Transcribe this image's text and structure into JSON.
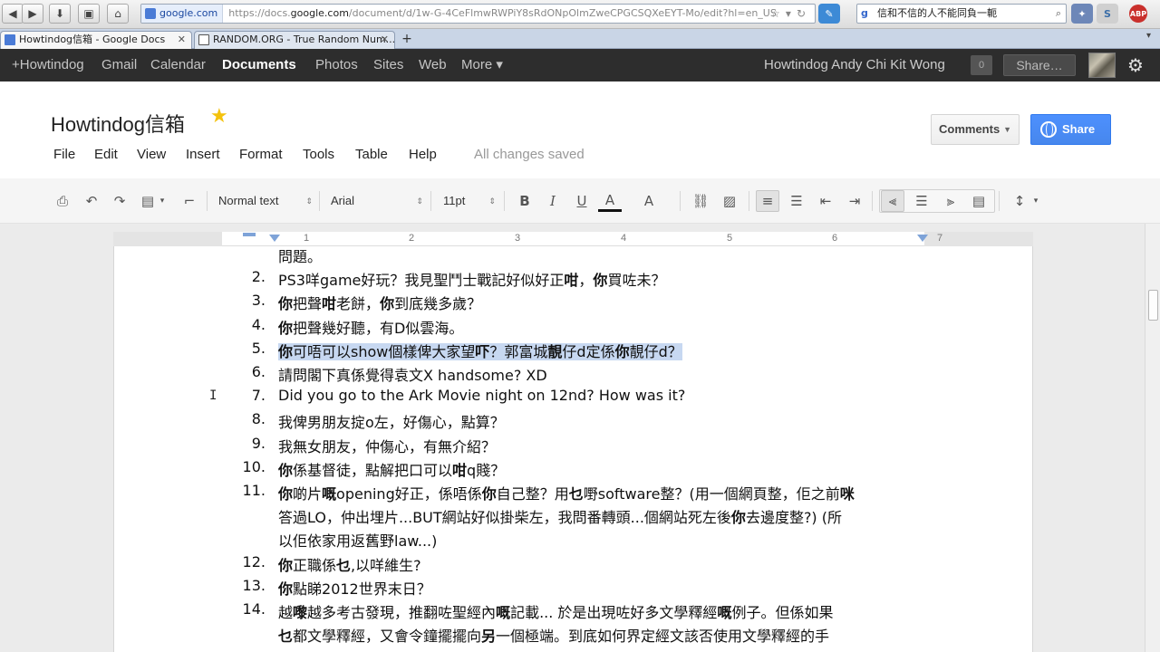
{
  "browser": {
    "url_domain": "google.com",
    "url_prefix": "https://docs.",
    "url_host": "google.com",
    "url_path": "/document/d/1w-G-4CeFlmwRWPiY8sRdONpOlmZweCPGCSQXeEYT-Mo/edit?hl=en_US",
    "search_text": "信和不信的人不能同負一軛",
    "tabs": [
      {
        "label": "Howtindog信箱 - Google Docs",
        "active": true,
        "color": "#4a7bd6"
      },
      {
        "label": "RANDOM.ORG - True Random Num...",
        "active": false,
        "color": "#555555"
      }
    ]
  },
  "gbar": {
    "links": [
      "+Howtindog",
      "Gmail",
      "Calendar",
      "Documents",
      "Photos",
      "Sites",
      "Web",
      "More ▾"
    ],
    "active": "Documents",
    "user": "Howtindog Andy Chi Kit Wong",
    "notification_count": "0",
    "share_label": "Share…"
  },
  "doc": {
    "title": "Howtindog信箱",
    "menu": [
      "File",
      "Edit",
      "View",
      "Insert",
      "Format",
      "Tools",
      "Table",
      "Help"
    ],
    "save_status": "All changes saved",
    "comments_label": "Comments",
    "share_label": "Share"
  },
  "toolbar": {
    "style": "Normal text",
    "font": "Arial",
    "size": "11pt"
  },
  "ruler": {
    "numbers": [
      "1",
      "2",
      "3",
      "4",
      "5",
      "6",
      "7"
    ]
  },
  "list": [
    {
      "num": "",
      "lines": [
        "問題。"
      ]
    },
    {
      "num": "2.",
      "lines": [
        "PS3咩game好玩？我見聖鬥士戰記好似好正<b>咁</b>，<b>你</b>買咗未？"
      ]
    },
    {
      "num": "3.",
      "lines": [
        "<b>你</b>把聲<b>咁</b>老餅，<b>你</b>到底幾多歲？"
      ]
    },
    {
      "num": "4.",
      "lines": [
        "<b>你</b>把聲幾好聽，有D似雲海。"
      ]
    },
    {
      "num": "5.",
      "lines": [
        "<span class=\"hl\"><b>你</b>可唔可以show個樣俾大家望<b>吓</b>？郭富城<b>靚</b>仔d定係<b>你</b>靚仔d？</span>"
      ]
    },
    {
      "num": "6.",
      "lines": [
        "請問閣下真係覺得袁文X handsome? XD"
      ]
    },
    {
      "num": "7.",
      "lines": [
        "Did you go to the Ark Movie night on 12nd? How was it?"
      ]
    },
    {
      "num": "8.",
      "lines": [
        "我俾男朋友掟o左，好傷心，點算？"
      ]
    },
    {
      "num": "9.",
      "lines": [
        "我無女朋友，仲傷心，有無介紹？"
      ]
    },
    {
      "num": "10.",
      "lines": [
        "<b>你</b>係基督徒，點解把口可以<b>咁</b>q賤？"
      ]
    },
    {
      "num": "11.",
      "lines": [
        "<b>你</b>啲片<b>嘅</b>opening好正，係唔係<b>你</b>自己整？用<b>乜</b>嘢software整？(用一個網頁整，佢之前<b>咪</b>",
        "答過LO，仲出埋片...BUT網站好似掛柴左，我問番轉頭...個網站死左後<b>你</b>去邊度整?) (所",
        "以佢依家用返舊野law...)"
      ]
    },
    {
      "num": "12.",
      "lines": [
        "<b>你</b>正職係<b>乜</b>,以咩維生?"
      ]
    },
    {
      "num": "13.",
      "lines": [
        "<b>你</b>點睇2012世界末日？"
      ]
    },
    {
      "num": "14.",
      "lines": [
        "越<b>嚟</b>越多考古發現，推翻咗聖經內<b>嘅</b>記載... 於是出現咗好多文學釋經<b>嘅</b>例子。但係如果",
        "<b>乜</b>都文學釋經，又會令鐘擺擺向<b>另</b>一個極端。到底如何界定經文該否使用文學釋經的手"
      ]
    }
  ],
  "colors": {
    "accent": "#4d90fe",
    "gbar_bg": "#2d2d2d",
    "star": "#f4c20d",
    "highlight": "#c7d8f1"
  }
}
